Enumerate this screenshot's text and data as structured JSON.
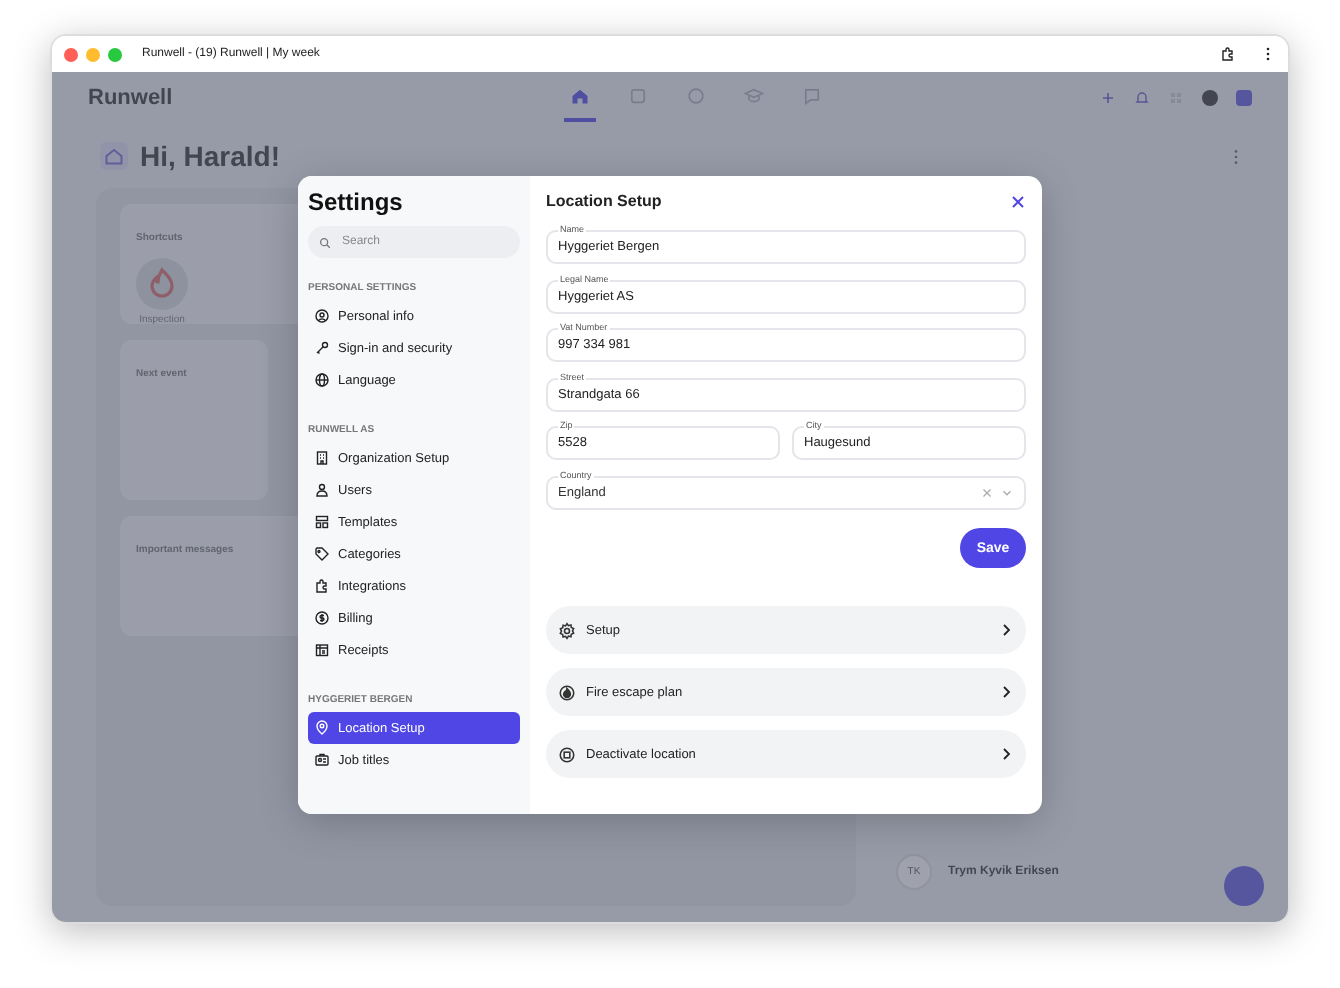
{
  "browser": {
    "title": "Runwell - (19) Runwell | My week"
  },
  "app": {
    "logo": "Runwell",
    "nav": [
      {
        "selected": true
      },
      {
        "selected": false
      },
      {
        "selected": false
      },
      {
        "selected": false
      },
      {
        "selected": false
      }
    ],
    "greeting": "Hi, Harald!",
    "shortcuts": {
      "title": "Shortcuts",
      "items": [
        "Inspection"
      ]
    },
    "next_event": {
      "title": "Next event"
    },
    "messages": {
      "title": "Important messages"
    },
    "people": [
      {
        "initials": "TK",
        "name": "Trym Kyvik Eriksen"
      }
    ]
  },
  "settings": {
    "title": "Settings",
    "search": {
      "placeholder": "Search"
    },
    "sections": [
      {
        "heading": "PERSONAL SETTINGS",
        "items": [
          {
            "label": "Personal info",
            "selected": false
          },
          {
            "label": "Sign-in and security",
            "selected": false
          },
          {
            "label": "Language",
            "selected": false
          }
        ]
      },
      {
        "heading": "RUNWELL AS",
        "items": [
          {
            "label": "Organization Setup",
            "selected": false
          },
          {
            "label": "Users",
            "selected": false
          },
          {
            "label": "Templates",
            "selected": false
          },
          {
            "label": "Categories",
            "selected": false
          },
          {
            "label": "Integrations",
            "selected": false
          },
          {
            "label": "Billing",
            "selected": false
          },
          {
            "label": "Receipts",
            "selected": false
          }
        ]
      },
      {
        "heading": "HYGGERIET BERGEN",
        "items": [
          {
            "label": "Location Setup",
            "selected": true
          },
          {
            "label": "Job titles",
            "selected": false
          }
        ]
      }
    ]
  },
  "location": {
    "title": "Location Setup",
    "fields": [
      {
        "label": "Name",
        "value": "Hyggeriet Bergen"
      },
      {
        "label": "Legal Name",
        "value": "Hyggeriet AS"
      },
      {
        "label": "Vat Number",
        "value": "997 334 981"
      },
      {
        "label": "Street",
        "value": "Strandgata 66"
      }
    ],
    "zip": {
      "label": "Zip",
      "value": "5528"
    },
    "city": {
      "label": "City",
      "value": "Haugesund"
    },
    "country": {
      "label": "Country",
      "value": "England"
    },
    "save": "Save",
    "actions": [
      {
        "label": "Setup"
      },
      {
        "label": "Fire escape plan"
      },
      {
        "label": "Deactivate location"
      }
    ]
  }
}
